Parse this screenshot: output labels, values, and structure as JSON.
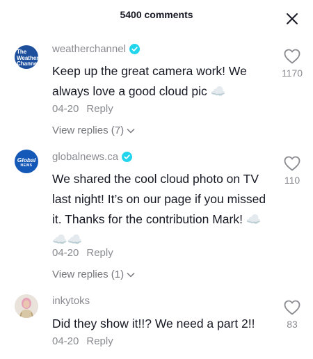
{
  "header": {
    "title": "5400 comments",
    "close_icon": "close-icon"
  },
  "colors": {
    "text": "#161823",
    "muted": "#8a8b91",
    "verified": "#20d5ec",
    "twc_blue": "#1d4f9c",
    "global_blue": "#1458b8"
  },
  "comments": [
    {
      "username": "weatherchannel",
      "verified": true,
      "avatar_text": [
        "The",
        "Weather",
        "Channel"
      ],
      "text": "Keep up the great camera work! We always love a good cloud pic ☁️",
      "date": "04-20",
      "reply_label": "Reply",
      "view_replies": "View replies (7)",
      "likes": "1170"
    },
    {
      "username": "globalnews.ca",
      "verified": true,
      "avatar_text": [
        "Global",
        "NEWS"
      ],
      "text": "We shared the cool cloud photo on TV last night! It’s on our page if you missed it. Thanks for the contribution Mark! ☁️☁️☁️",
      "date": "04-20",
      "reply_label": "Reply",
      "view_replies": "View replies (1)",
      "likes": "110"
    },
    {
      "username": "inkytoks",
      "verified": false,
      "text": "Did they show it!!? We need a part 2!!",
      "date": "04-20",
      "reply_label": "Reply",
      "likes": "83"
    }
  ]
}
